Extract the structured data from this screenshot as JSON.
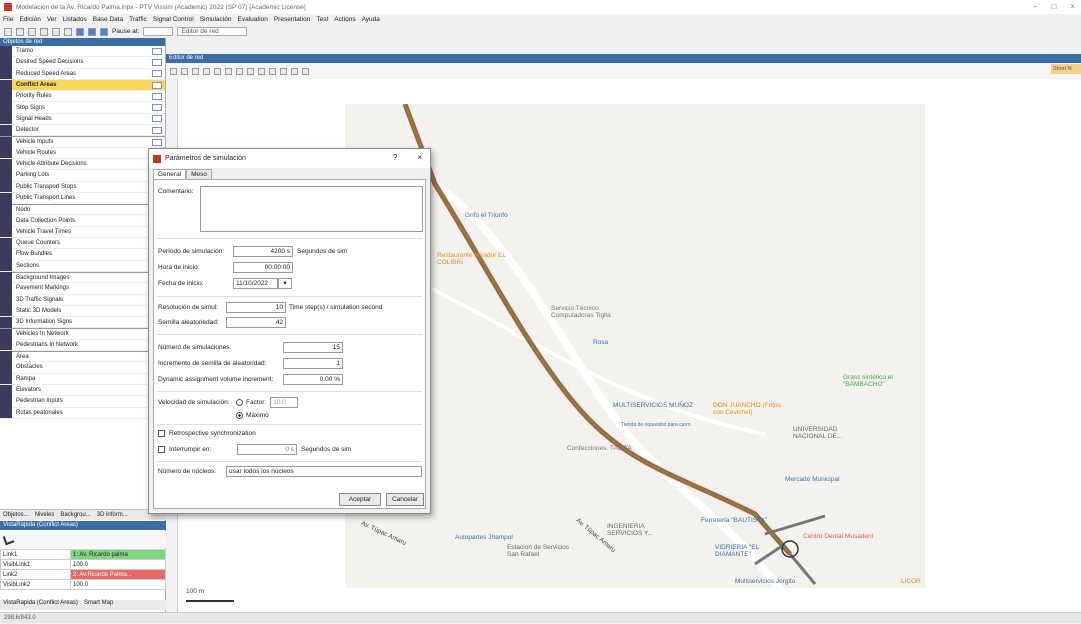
{
  "window": {
    "title": "Modelacion de la Av. Ricardo Palma.inpx - PTV Vissim (Academic) 2022 (SP 07) [Academic License]",
    "min": "–",
    "max": "□",
    "close": "×"
  },
  "menu": [
    "File",
    "Edición",
    "Ver",
    "Listados",
    "Base Data",
    "Traffic",
    "Signal Control",
    "Simulación",
    "Evaluation",
    "Presentation",
    "Test",
    "Actions",
    "Ayuda"
  ],
  "toolbar": {
    "pause_label": "Pause at:",
    "editor_field": "Editor de red"
  },
  "left_panel": {
    "title": "Objetos de red",
    "items": [
      {
        "label": "Tramo",
        "icon": "link-icon"
      },
      {
        "label": "Desired Speed Decisions",
        "icon": "speed-sign-icon"
      },
      {
        "label": "Reduced Speed Areas",
        "icon": "warning-icon"
      },
      {
        "label": "Conflict Areas",
        "icon": "conflict-icon",
        "selected": true
      },
      {
        "label": "Priority Rules",
        "icon": "priority-icon"
      },
      {
        "label": "Stop Signs",
        "icon": "stop-icon"
      },
      {
        "label": "Signal Heads",
        "icon": "signal-head-icon"
      },
      {
        "label": "Detector",
        "icon": "detector-icon"
      },
      {
        "label": "Vehicle Inputs",
        "icon": "vehicle-input-icon"
      },
      {
        "label": "Vehicle Routes",
        "icon": "route-icon"
      },
      {
        "label": "Vehicle Attribute Decisions",
        "icon": "attribute-icon"
      },
      {
        "label": "Parking Lots",
        "icon": "parking-icon"
      },
      {
        "label": "Public Transport Stops",
        "icon": "bus-stop-icon"
      },
      {
        "label": "Public Transport Lines",
        "icon": "bus-line-icon"
      },
      {
        "label": "Nodo",
        "icon": "node-icon"
      },
      {
        "label": "Data Collection Points",
        "icon": "data-point-icon"
      },
      {
        "label": "Vehicle Travel Times",
        "icon": "clock-icon"
      },
      {
        "label": "Queue Counters",
        "icon": "queue-icon"
      },
      {
        "label": "Flow Bundles",
        "icon": "flow-icon"
      },
      {
        "label": "Sections",
        "icon": "section-icon"
      },
      {
        "label": "Background Images",
        "icon": "image-icon"
      },
      {
        "label": "Pavement Markings",
        "icon": "marking-icon"
      },
      {
        "label": "3D Traffic Signals",
        "icon": "traffic-light-icon"
      },
      {
        "label": "Static 3D Models",
        "icon": "model-icon"
      },
      {
        "label": "3D Information Signs",
        "icon": "info-sign-icon"
      },
      {
        "label": "Vehicles In Network",
        "icon": "car-icon"
      },
      {
        "label": "Pedestrians In Network",
        "icon": "pedestrian-icon"
      },
      {
        "label": "Área",
        "icon": "area-icon"
      },
      {
        "label": "Obstacles",
        "icon": "obstacle-icon"
      },
      {
        "label": "Rampa",
        "icon": "ramp-icon"
      },
      {
        "label": "Elevators",
        "icon": "elevator-icon"
      },
      {
        "label": "Pedestrian Inputs",
        "icon": "ped-input-icon"
      },
      {
        "label": "Rutas peatonales",
        "icon": "ped-route-icon"
      }
    ],
    "tabs": [
      "Objetos...",
      "Niveles",
      "Backgrou...",
      "3D inform..."
    ]
  },
  "quick_view": {
    "title": "VistaRapida (Conflict Areas)",
    "rows": [
      {
        "key": "Link1",
        "value": "1: Av. Ricardo palma"
      },
      {
        "key": "VisibLink1",
        "value": "100.0"
      },
      {
        "key": "Link2",
        "value": "2: Av.Ricardo Palma..."
      },
      {
        "key": "VisibLink2",
        "value": "100.0"
      }
    ],
    "tabs": [
      "VistaRapida (Conflict Areas)",
      "Smart Map"
    ]
  },
  "editor": {
    "title": "Editor de red",
    "short_tab": "Short N"
  },
  "scale": "100 m",
  "status": "298.6/843.0",
  "map_labels": [
    "Restaurante Mirador EL COLIBRÍ",
    "Servicio Técnico Computadoras Tiglla",
    "Rosa",
    "MULTISERVICIOS MUÑOZ",
    "Tienda de repuestos para carro",
    "DON JUANCHO (Fritos con Cevichel)",
    "UNIVERSIDAD NACIONAL DE...",
    "Grass sintético el \"BAMBACHO\"",
    "Confecciones. TABITA",
    "Mercado Municipal",
    "Ferretería \"BAUTISTA\"",
    "Centro Dental Musadent",
    "VIDRIERIA \"EL DIAMANTE\"",
    "Multiservicios Jorgito",
    "INGENIERIA SERVICIOS Y...",
    "Estacion de Servicios San Rafael",
    "Autopartes Jhampol",
    "Av. Túpac Amaru",
    "Av. Túpac Amaru",
    "Grifo el Triunfo",
    "LICOR"
  ],
  "dialog": {
    "title": "Parámetros de simulación",
    "help": "?",
    "close": "×",
    "tabs": [
      "General",
      "Meso"
    ],
    "comment_label": "Comentario:",
    "period_label": "Período de simulación:",
    "period_value": "4200 s",
    "period_unit": "Segundos de sim",
    "start_time_label": "Hora de inicio:",
    "start_time_value": "00:00:00",
    "start_date_label": "Fecha de inicio:",
    "start_date_value": "11/10/2022",
    "resolution_label": "Resolución de simul:",
    "resolution_value": "10",
    "resolution_unit": "Time step(s) / simulation second",
    "seed_label": "Semilla aleatoriedad:",
    "seed_value": "42",
    "runs_label": "Número de simulaciones:",
    "runs_value": "15",
    "seed_inc_label": "Incremento de semilla de aleatoridad:",
    "seed_inc_value": "1",
    "dyn_label": "Dynamic assignment volume increment:",
    "dyn_value": "0.00 %",
    "speed_label": "Velocidad de simulación:",
    "factor_label": "Factor:",
    "factor_value": "10.0",
    "max_label": "Máximo",
    "retro_label": "Retrospective synchronization",
    "break_label": "Interrumpir en:",
    "break_value": "0 s",
    "break_unit": "Segundos de sim",
    "cores_label": "Número de núcleos:",
    "cores_value": "usar todos los núcleos",
    "accept": "Aceptar",
    "cancel": "Cancelar"
  },
  "colors": {
    "accent": "#3a6ea5",
    "selected": "#f7d65a",
    "link_red": "#d9443a",
    "link_green": "#3fa646"
  }
}
